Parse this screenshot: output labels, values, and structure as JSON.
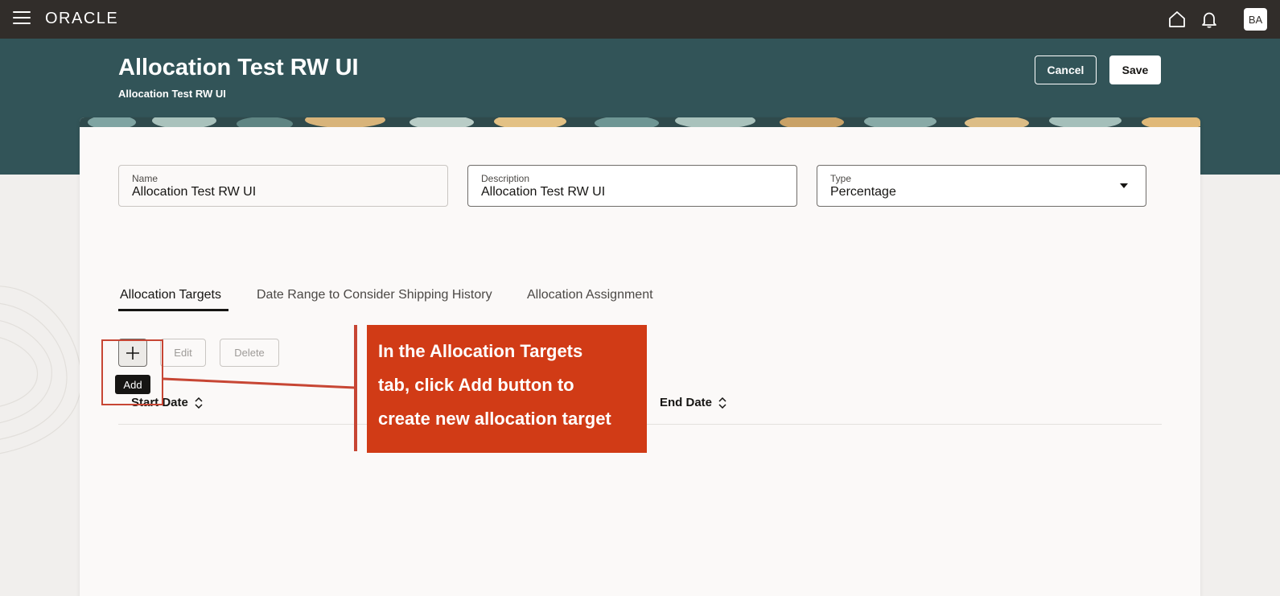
{
  "topbar": {
    "brand": "ORACLE",
    "avatar_initials": "BA",
    "icons": [
      "menu-icon",
      "home-icon",
      "bell-icon"
    ]
  },
  "header": {
    "title": "Allocation Test RW UI",
    "subtitle": "Allocation Test RW UI",
    "cancel_label": "Cancel",
    "save_label": "Save"
  },
  "form": {
    "name": {
      "label": "Name",
      "value": "Allocation Test RW UI"
    },
    "description": {
      "label": "Description",
      "value": "Allocation Test RW UI"
    },
    "type": {
      "label": "Type",
      "value": "Percentage"
    }
  },
  "tabs": [
    {
      "label": "Allocation Targets",
      "active": true
    },
    {
      "label": "Date Range to Consider Shipping History",
      "active": false
    },
    {
      "label": "Allocation Assignment",
      "active": false
    }
  ],
  "toolbar": {
    "add_tooltip": "Add",
    "edit_label": "Edit",
    "delete_label": "Delete"
  },
  "table": {
    "columns": [
      "Start Date",
      "End Date"
    ]
  },
  "callout": {
    "lines": [
      "In the Allocation Targets",
      "tab, click Add button to",
      "create new allocation target"
    ]
  },
  "colors": {
    "topbar": "#312d2a",
    "header": "#325458",
    "callout": "#d13b16",
    "highlight": "#c74634"
  }
}
